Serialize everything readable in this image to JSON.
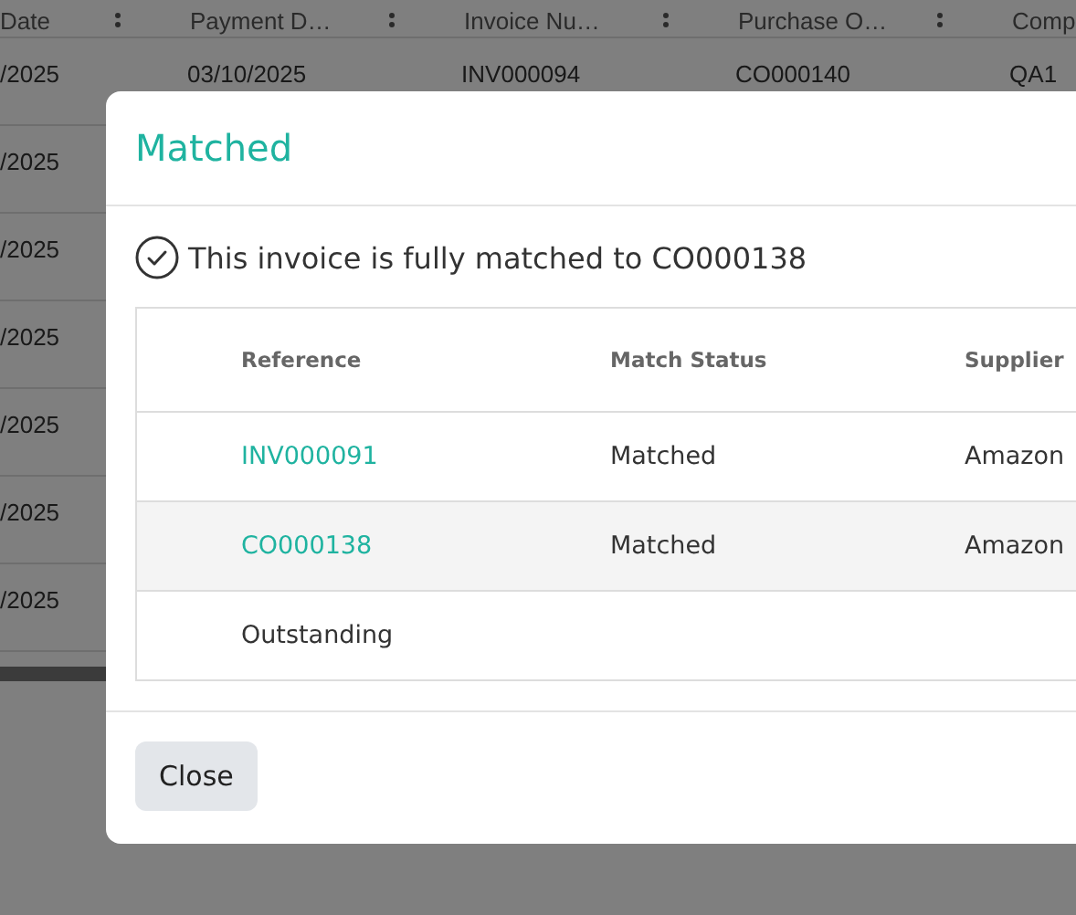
{
  "background_table": {
    "columns": [
      "Date",
      "Payment D…",
      "Invoice Nu…",
      "Purchase O…",
      "Comp"
    ],
    "rows": [
      [
        "/2025",
        "03/10/2025",
        "INV000094",
        "CO000140",
        "QA1"
      ],
      [
        "/2025"
      ],
      [
        "/2025"
      ],
      [
        "/2025"
      ],
      [
        "/2025"
      ],
      [
        "/2025"
      ],
      [
        "/2025"
      ]
    ]
  },
  "dialog": {
    "title": "Matched",
    "message": "This invoice is fully matched to CO000138",
    "table": {
      "columns": [
        "Reference",
        "Match Status",
        "Supplier"
      ],
      "rows": [
        {
          "kind": "link",
          "reference": "INV000091",
          "match_status": "Matched",
          "supplier": "Amazon"
        },
        {
          "kind": "link",
          "reference": "CO000138",
          "match_status": "Matched",
          "supplier": "Amazon"
        },
        {
          "kind": "text",
          "reference": "Outstanding"
        }
      ]
    },
    "buttons": [
      "Close"
    ]
  }
}
